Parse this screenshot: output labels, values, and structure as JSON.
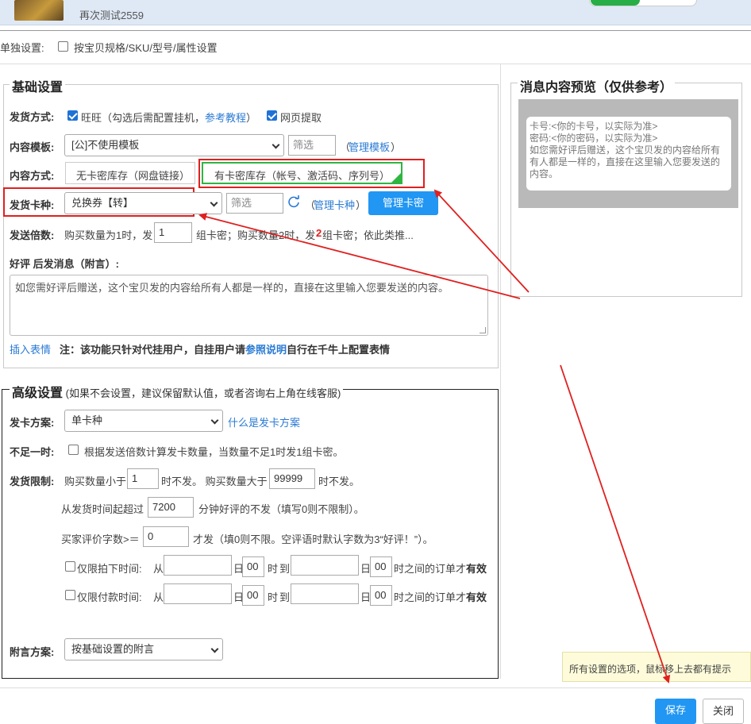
{
  "header": {
    "store_name": "再次测试2559"
  },
  "single_setting": {
    "label": "单独设置:",
    "option": "按宝贝规格/SKU/型号/属性设置"
  },
  "basic": {
    "title": "基础设置",
    "ship_method": {
      "label": "发货方式:",
      "wangwang": "旺旺（勾选后需配置挂机，",
      "tutorial": "参考教程",
      "close_paren": "）",
      "web": "网页提取"
    },
    "template": {
      "label": "内容模板:",
      "value": "[公]不使用模板",
      "filter_placeholder": "筛选",
      "open_paren": "（",
      "manage": "管理模板",
      "close_paren": "）"
    },
    "content_mode": {
      "label": "内容方式:",
      "option1": "无卡密库存（网盘链接）",
      "option2": "有卡密库存（帐号、激活码、序列号）"
    },
    "card_type": {
      "label": "发货卡种:",
      "value": "兑换券【转】",
      "filter_placeholder": "筛选",
      "open_paren": "（",
      "manage": "管理卡种",
      "close_paren": "）",
      "manage_btn": "管理卡密"
    },
    "multiple": {
      "label": "发送倍数:",
      "pre": "购买数量为1时，发",
      "value": "1",
      "mid": "组卡密；购买数量2时，发",
      "num": "2",
      "post": "组卡密；依此类推..."
    },
    "review": {
      "label": "好评 后发消息（附言）:",
      "placeholder": "如您需好评后赠送，这个宝贝发的内容给所有人都是一样的，直接在这里输入您要发送的内容。"
    },
    "emoji": {
      "link": "插入表情",
      "note_pre": "注：该功能只针对代挂用户，自挂用户请",
      "note_link": "参照说明",
      "note_post": "自行在千牛上配置表情"
    }
  },
  "advanced": {
    "title": "高级设置",
    "subtitle": "(如果不会设置，建议保留默认值，或者咨询右上角在线客服)",
    "plan": {
      "label": "发卡方案:",
      "value": "单卡种",
      "link": "什么是发卡方案"
    },
    "shortage": {
      "label": "不足一时:",
      "text": "根据发送倍数计算发卡数量，当数量不足1时发1组卡密。"
    },
    "limit": {
      "label": "发货限制:",
      "pre": "购买数量小于",
      "min": "1",
      "mid": "时不发。 购买数量大于",
      "max": "99999",
      "post": "时不发。"
    },
    "minutes": {
      "pre": "从发货时间起超过",
      "value": "7200",
      "post": "分钟好评的不发（填写0则不限制）。"
    },
    "words": {
      "pre": "买家评价字数>＝",
      "value": "0",
      "post": "才发（填0则不限。空评语时默认字数为3“好评！”）。"
    },
    "order_time": {
      "label": "仅限拍下时间:",
      "from": "从",
      "day1": "日",
      "h1": "00",
      "hour1": "时",
      "to": "到",
      "day2": "日",
      "h2": "00",
      "post": "时之间的订单才",
      "bold": "有效"
    },
    "pay_time": {
      "label": "仅限付款时间:",
      "from": "从",
      "day1": "日",
      "h1": "00",
      "hour1": "时",
      "to": "到",
      "day2": "日",
      "h2": "00",
      "post": "时之间的订单才",
      "bold": "有效"
    },
    "postscript": {
      "label": "附言方案:",
      "value": "按基础设置的附言"
    }
  },
  "preview": {
    "title": "消息内容预览（仅供参考）",
    "line1": "卡号:<你的卡号，以实际为准>",
    "line2": "密码:<你的密码，以实际为准>",
    "line3": "如您需好评后赠送，这个宝贝发的内容给所有有人都是一样的，直接在这里输入您要发送的内容。"
  },
  "tooltip": {
    "text": "所有设置的选项，鼠标移上去都有提示"
  },
  "footer": {
    "save": "保存",
    "close": "关闭"
  },
  "colors": {
    "accent": "#2196f3",
    "annotation_red": "#e02020",
    "selected_green": "#2fb541"
  }
}
